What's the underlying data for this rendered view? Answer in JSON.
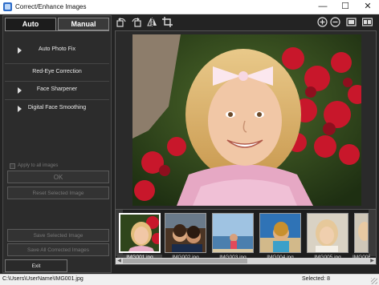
{
  "window": {
    "title": "Correct/Enhance Images",
    "controls": {
      "minimize": "—",
      "maximize": "☐",
      "close": "✕"
    }
  },
  "tabs": {
    "auto": "Auto",
    "manual": "Manual"
  },
  "auto_panel": {
    "options": [
      "Auto Photo Fix",
      "Red-Eye Correction",
      "Face Sharpener",
      "Digital Face Smoothing"
    ],
    "apply_all": "Apply to all images",
    "ok": "OK",
    "reset": "Reset Selected Image",
    "save_selected": "Save Selected Image",
    "save_all": "Save All Corrected Images",
    "exit": "Exit"
  },
  "toolbar": {
    "icons": [
      "rotate-left-icon",
      "rotate-right-icon",
      "flip-horizontal-icon",
      "crop-icon",
      "zoom-in-icon",
      "zoom-out-icon",
      "full-screen-icon",
      "compare-view-icon"
    ]
  },
  "thumbnails": [
    {
      "name": "IMG001.jpg",
      "selected": true
    },
    {
      "name": "IMG002.jpg",
      "selected": false
    },
    {
      "name": "IMG003.jpg",
      "selected": false
    },
    {
      "name": "IMG004.jpg",
      "selected": false
    },
    {
      "name": "IMG005.jpg",
      "selected": false
    },
    {
      "name": "IMG006.jpg",
      "selected": false
    }
  ],
  "status": {
    "path": "C:\\Users\\UserName\\IMG001.jpg",
    "selected": "Selected: 8"
  },
  "colors": {
    "panel_bg": "#232323",
    "accent_selected": "#ffffff"
  }
}
